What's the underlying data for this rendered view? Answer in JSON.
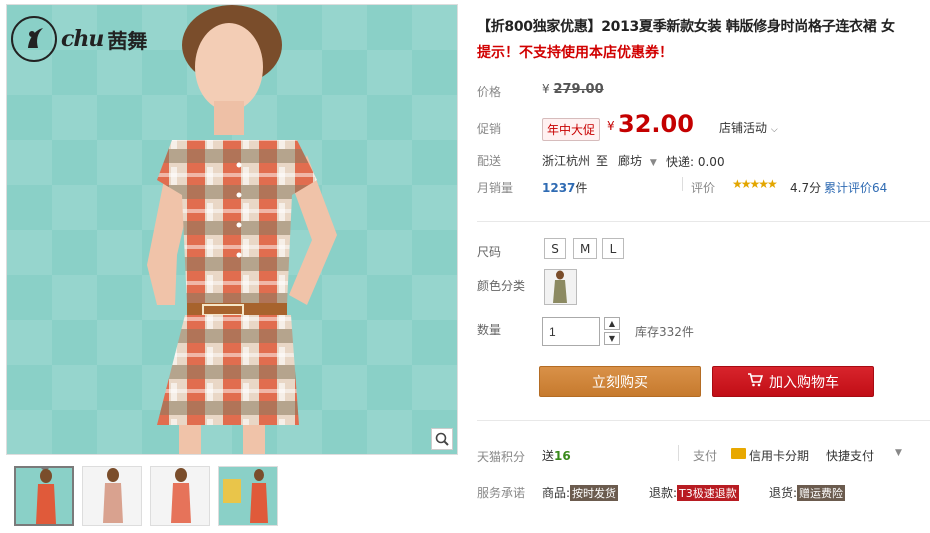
{
  "brand": {
    "latin": "chu",
    "cn": "茜舞"
  },
  "thumbnails": [
    "thumb-1",
    "thumb-2",
    "thumb-3",
    "thumb-4"
  ],
  "product": {
    "title": "【折800独家优惠】2013夏季新款女装 韩版修身时尚格子连衣裙 女",
    "subtitle": "提示！不支持使用本店优惠券！"
  },
  "price": {
    "label": "价格",
    "original": "279.00",
    "currency": "¥"
  },
  "promo": {
    "label": "促销",
    "tag": "年中大促",
    "currency": "¥",
    "price": "32.00",
    "store_event": "店铺活动",
    "store_event_icon": "chevron-down-icon"
  },
  "shipping": {
    "label": "配送",
    "from": "浙江杭州",
    "to_word": "至",
    "to": "廊坊",
    "express": "快递: 0.00"
  },
  "sales": {
    "label": "月销量",
    "count": "1237",
    "unit": "件",
    "review_label": "评价",
    "rating": "4.7分",
    "total_reviews": "累计评价64",
    "star_color": "#e3a600"
  },
  "size": {
    "label": "尺码",
    "options": [
      "S",
      "M",
      "L"
    ]
  },
  "color": {
    "label": "颜色分类"
  },
  "quantity": {
    "label": "数量",
    "value": "1",
    "stock": "库存332件"
  },
  "actions": {
    "buy_now": "立刻购买",
    "add_cart": "加入购物车",
    "buy_color": "#c87d32",
    "cart_color": "#c8141c"
  },
  "points": {
    "label": "天猫积分",
    "send_word": "送",
    "value": "16"
  },
  "payment": {
    "label": "支付",
    "credit": "信用卡分期",
    "quick": "快捷支付"
  },
  "service": {
    "label": "服务承诺",
    "goods_label": "商品:",
    "goods_tag": "按时发货",
    "refund_label": "退款:",
    "refund_tag": "T3极速退款",
    "return_label": "退货:",
    "return_tag": "赠运费险"
  }
}
